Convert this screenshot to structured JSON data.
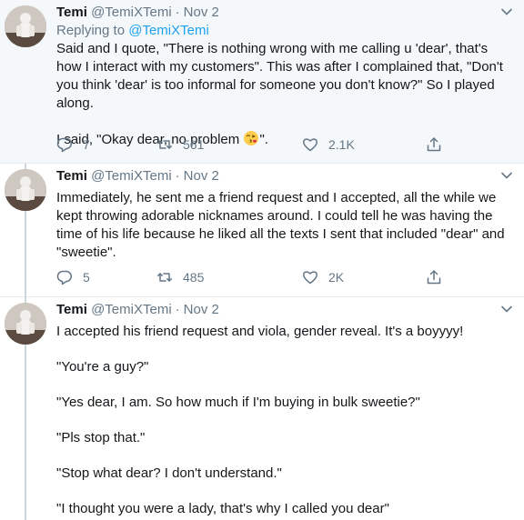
{
  "tweets": [
    {
      "name": "Temi",
      "handle": "@TemiXTemi",
      "date": "Nov 2",
      "replying_prefix": "Replying to",
      "replying_to": "@TemiXTemi",
      "paragraphs": [
        "Said and I quote, \"There is nothing wrong with me calling u 'dear', that's how I interact with my customers\". This was after I complained that, \"Don't you think 'dear' is too informal for someone you don't know?\" So I played along.",
        "I said, \"Okay dear, no problem",
        "\"."
      ],
      "replies": "7",
      "retweets": "561",
      "likes": "2.1K"
    },
    {
      "name": "Temi",
      "handle": "@TemiXTemi",
      "date": "Nov 2",
      "paragraphs": [
        "Immediately, he sent me a friend request and I accepted, all the while we kept throwing adorable nicknames around. I could tell he was having the time of his life because he liked all the texts I sent that included \"dear\" and \"sweetie\"."
      ],
      "replies": "5",
      "retweets": "485",
      "likes": "2K"
    },
    {
      "name": "Temi",
      "handle": "@TemiXTemi",
      "date": "Nov 2",
      "paragraphs": [
        "I accepted his friend request and viola, gender reveal. It's a boyyyy!",
        "\"You're a guy?\"",
        "\"Yes dear, I am. So how much if I'm buying in bulk sweetie?\"",
        "\"Pls stop that.\"",
        "\"Stop what dear? I don't understand.\"",
        "\"I thought you were a lady, that's why I called you dear\""
      ]
    }
  ],
  "dot": "·",
  "icons": {
    "reply": "reply-icon",
    "retweet": "retweet-icon",
    "like": "heart-icon",
    "share": "share-icon",
    "more": "chevron-down-icon",
    "emoji": "face-blowing-kiss-emoji"
  },
  "colors": {
    "name": "#14171a",
    "muted": "#657786",
    "link": "#1da1f2",
    "highlight_bg": "#f5f8fa",
    "divider": "#e6ecf0",
    "thread_line": "#ccd6dd"
  }
}
